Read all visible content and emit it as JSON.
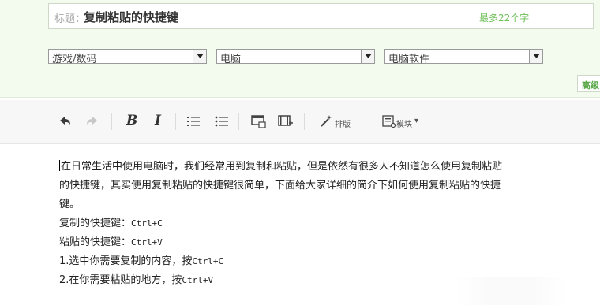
{
  "title_prefix": "标题：",
  "title_value": "复制粘贴的快捷键",
  "title_hint": "最多22个字",
  "category1": "游戏/数码",
  "category2": "电脑",
  "category3": "电脑软件",
  "advanced_tab": "高级",
  "toolbar": {
    "bold": "B",
    "italic": "I",
    "typeset_label": "排版",
    "module_label": "模块",
    "module_caret": "▾"
  },
  "content": {
    "paragraph_lines": [
      "在日常生活中使用电脑时，我们经常用到复制和粘贴，但是依然有很多人不知道怎么使用复制粘贴",
      "的快捷键，其实使用复制粘贴的快捷键很简单，下面给大家详细的简介下如何使用复制粘贴的快捷",
      "键。"
    ],
    "copy_label": "复制的快捷键：",
    "copy_key": "Ctrl+C",
    "paste_label": "粘贴的快捷键：",
    "paste_key": "Ctrl+V",
    "step1_text": "1.选中你需要复制的内容，按",
    "step1_key": "Ctrl+C",
    "step2_text": "2.在你需要粘贴的地方，按",
    "step2_key": "Ctrl+V"
  },
  "colors": {
    "top_panel_bg": "#f2fbee",
    "hint_green": "#6fbf5a",
    "toolbar_bg": "#f7f7f7"
  }
}
